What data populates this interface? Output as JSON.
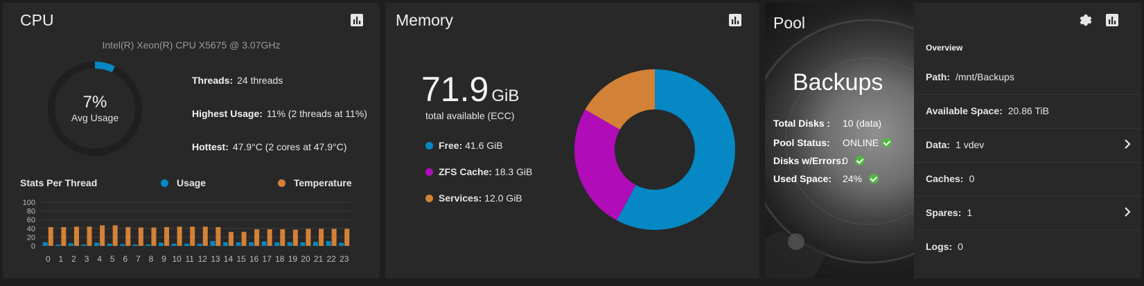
{
  "cpu": {
    "title": "CPU",
    "model": "Intel(R) Xeon(R) CPU X5675 @ 3.07GHz",
    "avg_usage_pct": 7,
    "avg_usage_text": "7%",
    "avg_usage_label": "Avg Usage",
    "threads_label": "Threads:",
    "threads_value": "24 threads",
    "highest_label": "Highest Usage:",
    "highest_value": "11%  (2 threads at 11%)",
    "hottest_label": "Hottest:",
    "hottest_value": "47.9°C  (2 cores at 47.9°C)",
    "stats_label": "Stats Per Thread",
    "usage_legend": "Usage",
    "temp_legend": "Temperature",
    "icon": "bar-chart-icon"
  },
  "memory": {
    "title": "Memory",
    "total_value": "71.9",
    "total_unit": "GiB",
    "total_label": "total available (ECC)",
    "legend": [
      {
        "label": "Free:",
        "value": "41.6 GiB",
        "color": "#0588c3"
      },
      {
        "label": "ZFS Cache:",
        "value": "18.3 GiB",
        "color": "#b00cb8"
      },
      {
        "label": "Services:",
        "value": "12.0 GiB",
        "color": "#d38137"
      }
    ],
    "icon": "bar-chart-icon"
  },
  "pool": {
    "title": "Pool",
    "name": "Backups",
    "total_disks_label": "Total Disks :",
    "total_disks_value": "10 (data)",
    "status_label": "Pool Status:",
    "status_value": "ONLINE",
    "errors_label": "Disks w/Errors:",
    "errors_value": "0",
    "used_label": "Used Space:",
    "used_value": "24%",
    "overview_header": "Overview",
    "overview": [
      {
        "label": "Path:",
        "value": "/mnt/Backups",
        "has_chevron": false
      },
      {
        "label": "Available Space:",
        "value": "20.86 TiB",
        "has_chevron": false
      },
      {
        "label": "Data:",
        "value": "1 vdev",
        "has_chevron": true
      },
      {
        "label": "Caches:",
        "value": "0",
        "has_chevron": false
      },
      {
        "label": "Spares:",
        "value": "1",
        "has_chevron": true
      },
      {
        "label": "Logs:",
        "value": "0",
        "has_chevron": false
      }
    ],
    "icons": [
      "gear-icon",
      "bar-chart-icon"
    ]
  },
  "colors": {
    "usage": "#0588c3",
    "temperature": "#d38137",
    "free": "#0588c3",
    "zfs_cache": "#b00cb8",
    "services": "#d38137",
    "ok": "#55b542"
  },
  "chart_data": [
    {
      "type": "bar",
      "title": "Stats Per Thread",
      "categories": [
        "0",
        "1",
        "2",
        "3",
        "4",
        "5",
        "6",
        "7",
        "8",
        "9",
        "10",
        "11",
        "12",
        "13",
        "14",
        "15",
        "16",
        "17",
        "18",
        "19",
        "20",
        "21",
        "22",
        "23"
      ],
      "series": [
        {
          "name": "Usage",
          "values": [
            8,
            3,
            6,
            3,
            7,
            5,
            4,
            3,
            3,
            7,
            5,
            5,
            5,
            11,
            8,
            8,
            8,
            10,
            8,
            8,
            8,
            9,
            11,
            7
          ]
        },
        {
          "name": "Temperature",
          "values": [
            43,
            43,
            44,
            44,
            47,
            47,
            43,
            42,
            42,
            43,
            44,
            44,
            44,
            43,
            32,
            32,
            38,
            38,
            38,
            37,
            39,
            39,
            39,
            39
          ]
        }
      ],
      "ylim": [
        0,
        100
      ],
      "yticks": [
        0,
        20,
        40,
        60,
        80,
        100
      ]
    },
    {
      "type": "pie",
      "categories": [
        "Free",
        "ZFS Cache",
        "Services"
      ],
      "values": [
        41.6,
        18.3,
        12.0
      ],
      "unit": "GiB"
    }
  ]
}
